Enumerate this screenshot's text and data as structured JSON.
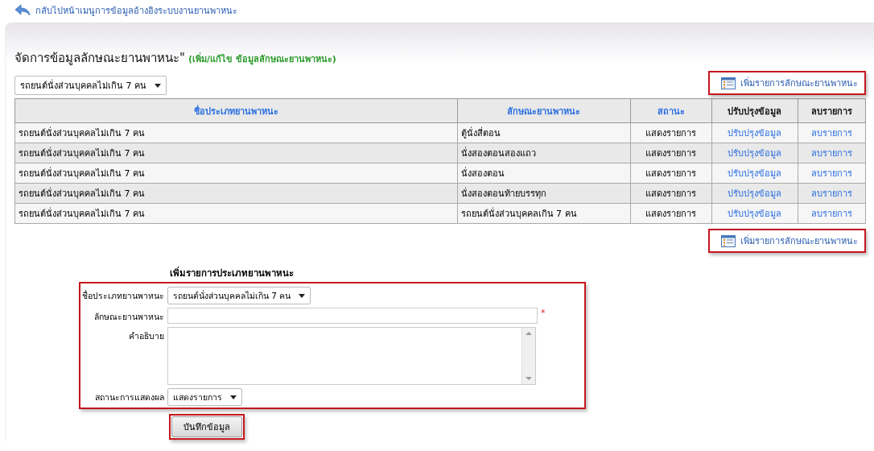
{
  "back_link": {
    "label": "กลับไปหน้าเมนูการข้อมูลอ้างอิงระบบงานยานพาหนะ"
  },
  "page_title": "จัดการข้อมูลลักษณะยานพาหนะ\"",
  "page_subtitle": "(เพิ่ม/แก้ไข ข้อมูลลักษณะยานพาหนะ)",
  "type_filter": {
    "value": "รถยนต์นั่งส่วนบุคคลไม่เกิน 7 คน"
  },
  "add_link_top": {
    "label": "เพิ่มรายการลักษณะยานพาหนะ"
  },
  "table": {
    "columns": [
      {
        "label": "ชื่อประเภทยานพาหนะ",
        "kind": "link"
      },
      {
        "label": "ลักษณะยานพาหนะ",
        "kind": "link"
      },
      {
        "label": "สถานะ",
        "kind": "link"
      },
      {
        "label": "ปรับปรุงข้อมูล",
        "kind": "plain"
      },
      {
        "label": "ลบรายการ",
        "kind": "plain"
      }
    ],
    "rows": [
      {
        "type": "รถยนต์นั่งส่วนบุคคลไม่เกิน 7 คน",
        "characteristic": "ตู้นั่งสี่ตอน",
        "status": "แสดงรายการ",
        "edit": "ปรับปรุงข้อมูล",
        "delete": "ลบรายการ"
      },
      {
        "type": "รถยนต์นั่งส่วนบุคคลไม่เกิน 7 คน",
        "characteristic": "นั่งสองตอนสองแถว",
        "status": "แสดงรายการ",
        "edit": "ปรับปรุงข้อมูล",
        "delete": "ลบรายการ"
      },
      {
        "type": "รถยนต์นั่งส่วนบุคคลไม่เกิน 7 คน",
        "characteristic": "นั่งสองตอน",
        "status": "แสดงรายการ",
        "edit": "ปรับปรุงข้อมูล",
        "delete": "ลบรายการ"
      },
      {
        "type": "รถยนต์นั่งส่วนบุคคลไม่เกิน 7 คน",
        "characteristic": "นั่งสองตอนท้ายบรรทุก",
        "status": "แสดงรายการ",
        "edit": "ปรับปรุงข้อมูล",
        "delete": "ลบรายการ"
      },
      {
        "type": "รถยนต์นั่งส่วนบุคคลไม่เกิน 7 คน",
        "characteristic": "รถยนต์นั่งส่วนบุคคลเกิน 7 คน",
        "status": "แสดงรายการ",
        "edit": "ปรับปรุงข้อมูล",
        "delete": "ลบรายการ"
      }
    ]
  },
  "add_link_bottom": {
    "label": "เพิ่มรายการลักษณะยานพาหนะ"
  },
  "form": {
    "heading": "เพิ่มรายการประเภทยานพาหนะ",
    "fields": [
      {
        "kind": "select",
        "label": "ชื่อประเภทยานพาหนะ",
        "value": "รถยนต์นั่งส่วนบุคคลไม่เกิน 7 คน"
      },
      {
        "kind": "text",
        "label": "ลักษณะยานพาหนะ",
        "required_mark": "*"
      },
      {
        "kind": "textarea",
        "label": "คำอธิบาย"
      },
      {
        "kind": "select",
        "label": "สถานะการแสดงผล",
        "value": "แสดงรายการ"
      }
    ],
    "save_button": "บันทึกข้อมูล"
  }
}
